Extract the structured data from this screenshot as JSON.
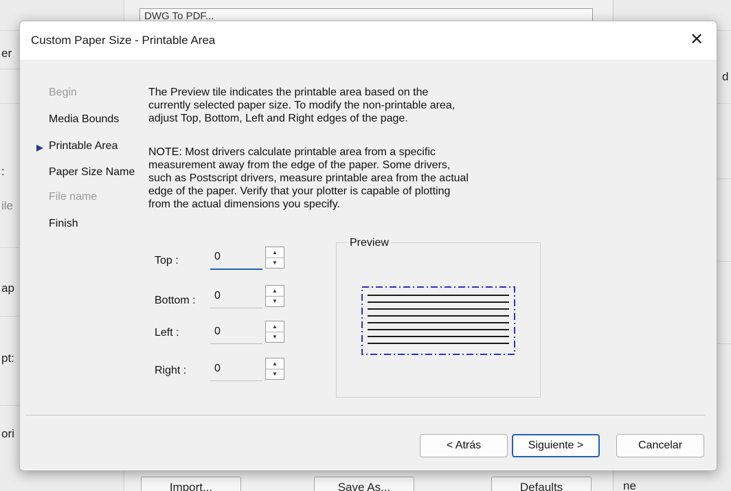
{
  "background": {
    "left_labels": [
      "er",
      ":",
      "ile",
      "ap",
      "pt:",
      "ori"
    ],
    "combo_text": "DWG To PDF...",
    "buttons": [
      "Import...",
      "Save As...",
      "Defaults"
    ],
    "right_labels": [
      "d",
      "ne"
    ]
  },
  "dialog": {
    "title": "Custom Paper Size - Printable Area",
    "close_glyph": "✕"
  },
  "steps": [
    {
      "label": "Begin",
      "state": "disabled"
    },
    {
      "label": "Media Bounds",
      "state": "normal"
    },
    {
      "label": "Printable Area",
      "state": "current"
    },
    {
      "label": "Paper Size Name",
      "state": "normal"
    },
    {
      "label": "File name",
      "state": "disabled"
    },
    {
      "label": "Finish",
      "state": "normal"
    }
  ],
  "current_step_marker": "▶",
  "description": {
    "p1": [
      "The Preview tile indicates the printable area based on the",
      "currently selected paper size. To modify the non-printable area,",
      "adjust Top, Bottom, Left and Right edges of the page."
    ],
    "p2": [
      "NOTE: Most drivers calculate printable area from a specific",
      "measurement away from the edge of the paper. Some drivers,",
      "such as Postscript drivers, measure printable area from the actual",
      "edge of the paper. Verify that your plotter is capable of plotting",
      "from the actual dimensions you specify."
    ]
  },
  "fields": {
    "top": {
      "label": "Top :",
      "value": "0"
    },
    "bottom": {
      "label": "Bottom :",
      "value": "0"
    },
    "left": {
      "label": "Left :",
      "value": "0"
    },
    "right": {
      "label": "Right :",
      "value": "0"
    }
  },
  "spin_glyphs": {
    "up": "▲",
    "down": "▼"
  },
  "preview": {
    "label": "Preview",
    "border_color": "#2e2ecc",
    "line_color": "#1a1a1a"
  },
  "buttons": {
    "back": "< Atrás",
    "next": "Siguiente >",
    "cancel": "Cancelar"
  },
  "colors": {
    "accent": "#1f5fbf",
    "marker": "#1f3c88"
  }
}
